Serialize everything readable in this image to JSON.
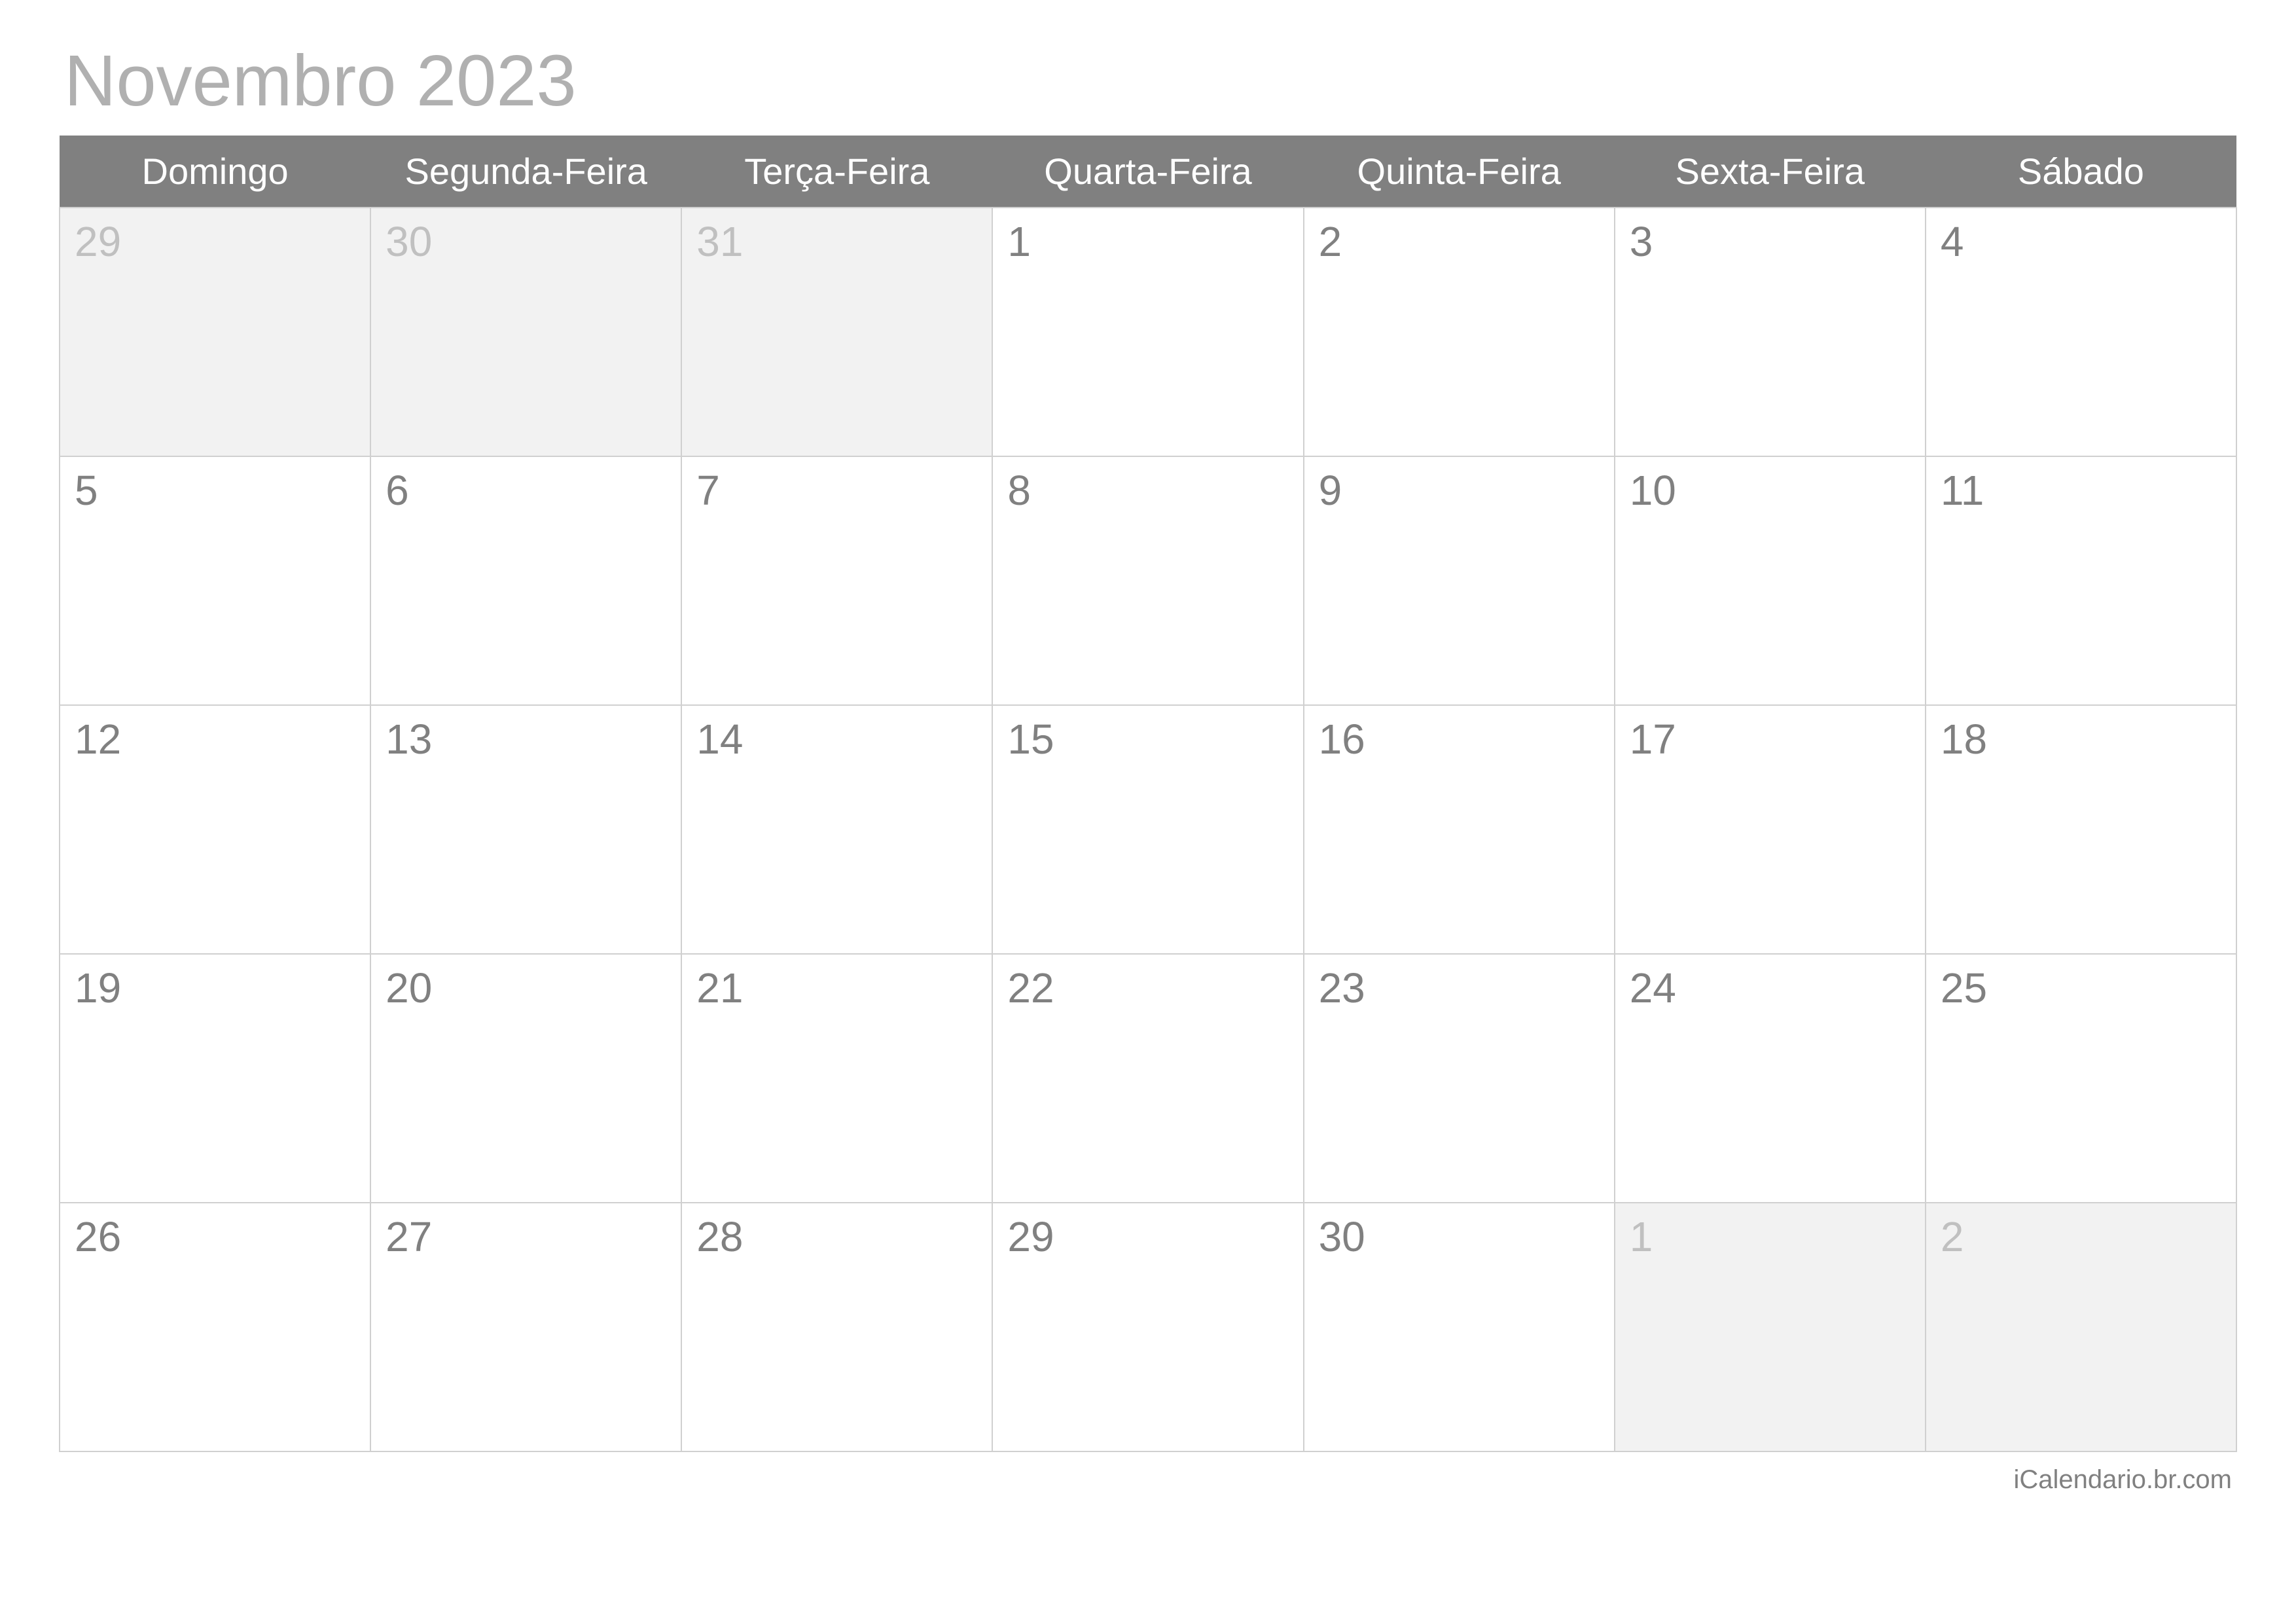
{
  "title": "Novembro 2023",
  "weekdays": [
    "Domingo",
    "Segunda-Feira",
    "Terça-Feira",
    "Quarta-Feira",
    "Quinta-Feira",
    "Sexta-Feira",
    "Sábado"
  ],
  "weeks": [
    [
      {
        "day": "29",
        "out": true
      },
      {
        "day": "30",
        "out": true
      },
      {
        "day": "31",
        "out": true
      },
      {
        "day": "1",
        "out": false
      },
      {
        "day": "2",
        "out": false
      },
      {
        "day": "3",
        "out": false
      },
      {
        "day": "4",
        "out": false
      }
    ],
    [
      {
        "day": "5",
        "out": false
      },
      {
        "day": "6",
        "out": false
      },
      {
        "day": "7",
        "out": false
      },
      {
        "day": "8",
        "out": false
      },
      {
        "day": "9",
        "out": false
      },
      {
        "day": "10",
        "out": false
      },
      {
        "day": "11",
        "out": false
      }
    ],
    [
      {
        "day": "12",
        "out": false
      },
      {
        "day": "13",
        "out": false
      },
      {
        "day": "14",
        "out": false
      },
      {
        "day": "15",
        "out": false
      },
      {
        "day": "16",
        "out": false
      },
      {
        "day": "17",
        "out": false
      },
      {
        "day": "18",
        "out": false
      }
    ],
    [
      {
        "day": "19",
        "out": false
      },
      {
        "day": "20",
        "out": false
      },
      {
        "day": "21",
        "out": false
      },
      {
        "day": "22",
        "out": false
      },
      {
        "day": "23",
        "out": false
      },
      {
        "day": "24",
        "out": false
      },
      {
        "day": "25",
        "out": false
      }
    ],
    [
      {
        "day": "26",
        "out": false
      },
      {
        "day": "27",
        "out": false
      },
      {
        "day": "28",
        "out": false
      },
      {
        "day": "29",
        "out": false
      },
      {
        "day": "30",
        "out": false
      },
      {
        "day": "1",
        "out": true
      },
      {
        "day": "2",
        "out": true
      }
    ]
  ],
  "footer": "iCalendario.br.com"
}
